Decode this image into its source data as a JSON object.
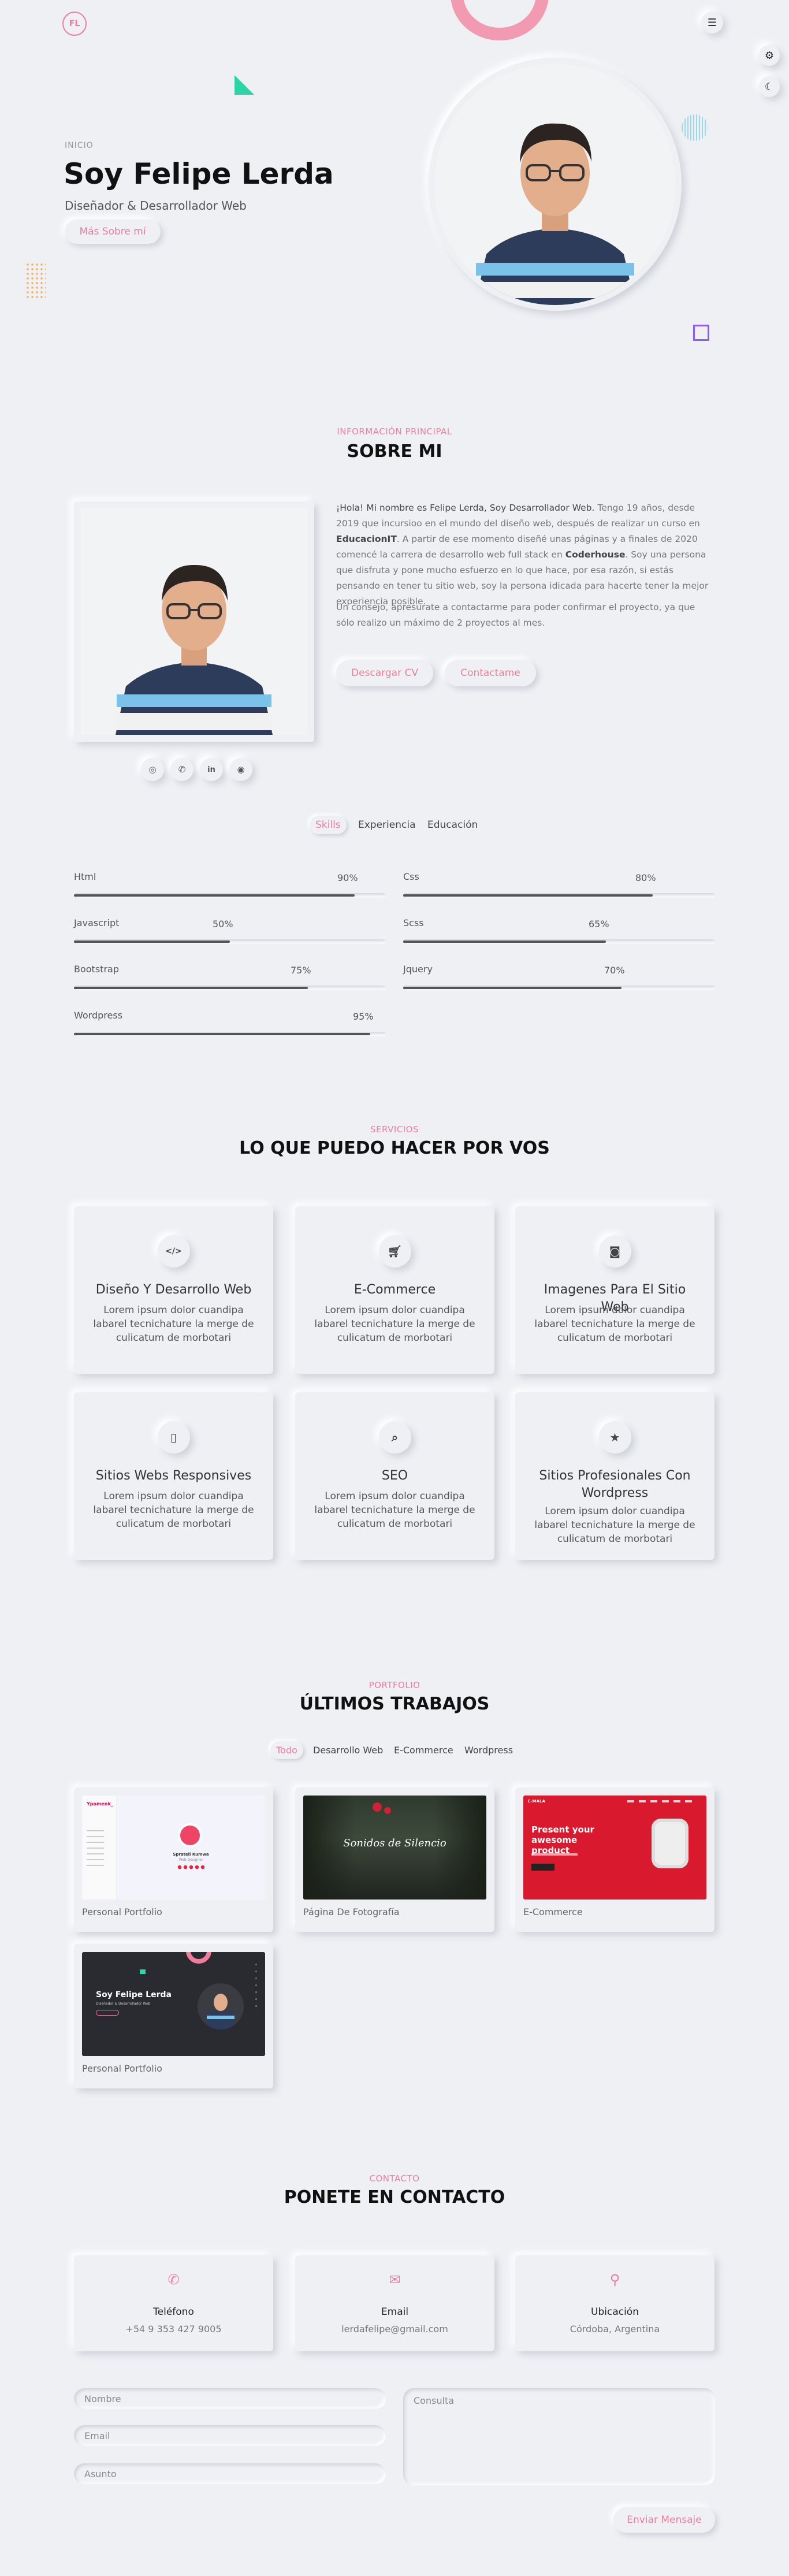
{
  "nav": {
    "logo": "FL",
    "menu_icon": "menu-icon"
  },
  "side_tools": {
    "settings_icon": "gear-icon",
    "theme_icon": "moon-icon"
  },
  "hero": {
    "kicker": "INICIO",
    "title": "Soy Felipe Lerda",
    "subtitle": "Diseñador & Desarrollador Web",
    "button": "Más Sobre mí"
  },
  "about": {
    "kicker": "INFORMACIÓN PRINCIPAL",
    "title": "SOBRE MI",
    "p1_lead": "¡Hola! Mi nombre es Felipe Lerda, Soy Desarrollador Web.",
    "p1_a": " Tengo 19 años, desde 2019 que incursioo en el mundo del diseño web, después de realizar un curso en ",
    "p1_b": "EducacionIT",
    "p1_c": ". A partir de ese momento diseñé unas páginas y a finales de 2020 comencé la carrera de desarrollo web full stack en ",
    "p1_d": "Coderhouse",
    "p1_e": ". Soy una persona que disfruta y pone mucho esfuerzo en lo que hace, por esa razón, si estás pensando en tener tu sitio web, soy la persona idicada para hacerte tener la mejor experiencia posible.",
    "p2": "Un consejo, apresurate a contactarme para poder confirmar el proyecto, ya que sólo realizo un máximo de 2 proyectos al mes.",
    "btn_cv": "Descargar CV",
    "btn_contact": "Contactame",
    "socials": [
      "instagram-icon",
      "whatsapp-icon",
      "linkedin-icon",
      "github-icon"
    ]
  },
  "tabs": [
    "Skills",
    "Experiencia",
    "Educación"
  ],
  "skills": [
    {
      "name": "Html",
      "pct": "90%",
      "value": 90
    },
    {
      "name": "Css",
      "pct": "80%",
      "value": 80
    },
    {
      "name": "Javascript",
      "pct": "50%",
      "value": 50
    },
    {
      "name": "Scss",
      "pct": "65%",
      "value": 65
    },
    {
      "name": "Bootstrap",
      "pct": "75%",
      "value": 75
    },
    {
      "name": "Jquery",
      "pct": "70%",
      "value": 70
    },
    {
      "name": "Wordpress",
      "pct": "95%",
      "value": 95
    }
  ],
  "services": {
    "kicker": "SERVICIOS",
    "title": "LO QUE PUEDO HACER POR VOS",
    "items": [
      {
        "title": "Diseño Y Desarrollo Web",
        "text": "Lorem ipsum dolor cuandipa labarel tecnichature la merge de culicatum de morbotari",
        "icon": "code-icon"
      },
      {
        "title": "E-Commerce",
        "text": "Lorem ipsum dolor cuandipa labarel tecnichature la merge de culicatum de morbotari",
        "icon": "cart-icon"
      },
      {
        "title": "Imagenes Para El Sitio Web",
        "text": "Lorem ipsum dolor cuandipa labarel tecnichature la merge de culicatum de morbotari",
        "icon": "camera-icon"
      },
      {
        "title": "Sitios Webs Responsives",
        "text": "Lorem ipsum dolor cuandipa labarel tecnichature la merge de culicatum de morbotari",
        "icon": "mobile-icon"
      },
      {
        "title": "SEO",
        "text": "Lorem ipsum dolor cuandipa labarel tecnichature la merge de culicatum de morbotari",
        "icon": "search-icon"
      },
      {
        "title": "Sitios Profesionales Con Wordpress",
        "text": "Lorem ipsum dolor cuandipa labarel tecnichature la merge de culicatum de morbotari",
        "icon": "star-icon"
      }
    ]
  },
  "portfolio": {
    "kicker": "PORTFOLIO",
    "title": "ÚLTIMOS TRABAJOS",
    "filters": [
      "Todo",
      "Desarrollo Web",
      "E-Commerce",
      "Wordpress"
    ],
    "items": [
      {
        "label": "Personal Portfolio",
        "thumb": {
          "brand": "Ypomenk_",
          "name": "Sprateli Kumwa",
          "role": "Web Designer"
        }
      },
      {
        "label": "Página De Fotografía",
        "thumb": {
          "heading": "Sonidos de Silencio"
        }
      },
      {
        "label": "E-Commerce",
        "thumb": {
          "brand": "E-MALA",
          "headline": "Present your awesome product"
        }
      },
      {
        "label": "Personal Portfolio",
        "thumb": {
          "heading": "Soy Felipe Lerda",
          "sub": "Diseñador & Desarrollador Web"
        }
      }
    ]
  },
  "contact": {
    "kicker": "CONTACTO",
    "title": "PONETE EN CONTACTO",
    "cards": [
      {
        "title": "Teléfono",
        "value": "+54 9 353 427 9005",
        "icon": "phone-icon"
      },
      {
        "title": "Email",
        "value": "lerdafelipe@gmail.com",
        "icon": "envelope-icon"
      },
      {
        "title": "Ubicación",
        "value": "Córdoba, Argentina",
        "icon": "location-pin-icon"
      }
    ],
    "form": {
      "name": "Nombre",
      "email": "Email",
      "subject": "Asunto",
      "message": "Consulta",
      "submit": "Enviar Mensaje"
    }
  },
  "colors": {
    "accent": "#f17d9b",
    "background": "#eef0f4",
    "ecommerce_red": "#d8192e",
    "teal": "#2dd4a7",
    "purple": "#8b5cf6"
  }
}
